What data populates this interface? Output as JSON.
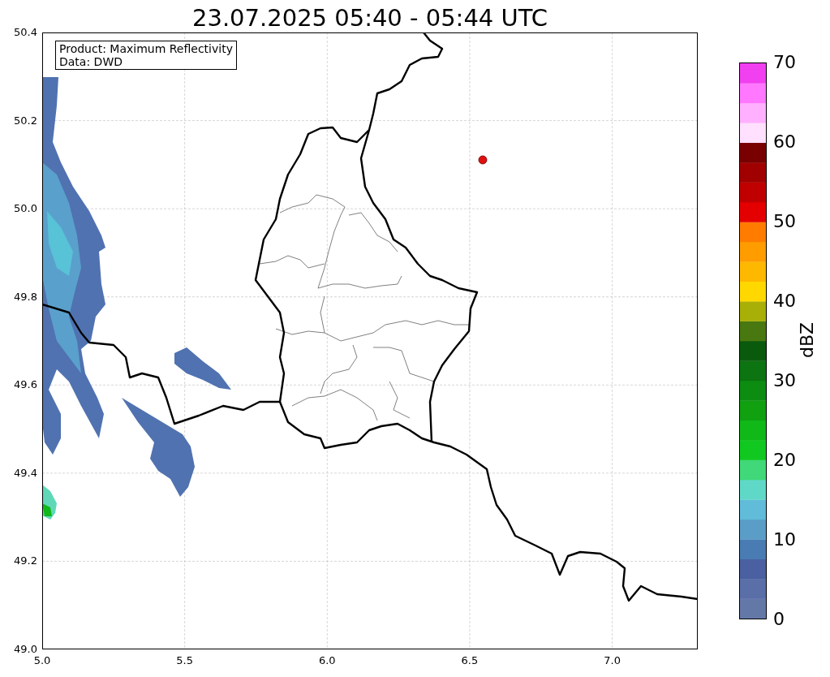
{
  "title": "23.07.2025 05:40 - 05:44 UTC",
  "map": {
    "info_box": [
      "Product: Maximum Reflectivity",
      "Data: DWD"
    ],
    "x_ticks": [
      "5.0",
      "5.5",
      "6.0",
      "6.5",
      "7.0"
    ],
    "y_ticks": [
      "50.4",
      "50.2",
      "50.0",
      "49.8",
      "49.6",
      "49.4",
      "49.2",
      "49.0"
    ]
  },
  "colorbar": {
    "label": "dBZ",
    "ticks": [
      "70",
      "60",
      "50",
      "40",
      "30",
      "20",
      "10",
      "0"
    ],
    "bands": [
      {
        "color": "#6478a8"
      },
      {
        "color": "#5a6ea8"
      },
      {
        "color": "#4a60a0"
      },
      {
        "color": "#4a7cb4"
      },
      {
        "color": "#5a9ec8"
      },
      {
        "color": "#60bcd8"
      },
      {
        "color": "#60d8c8"
      },
      {
        "color": "#40d878"
      },
      {
        "color": "#10c820"
      },
      {
        "color": "#10b818"
      },
      {
        "color": "#10a010"
      },
      {
        "color": "#0c8c10"
      },
      {
        "color": "#0c7410"
      },
      {
        "color": "#0a5a0e"
      },
      {
        "color": "#4a7810"
      },
      {
        "color": "#a8b008"
      },
      {
        "color": "#ffd800"
      },
      {
        "color": "#ffb800"
      },
      {
        "color": "#ff9c00"
      },
      {
        "color": "#ff7c00"
      },
      {
        "color": "#e40000"
      },
      {
        "color": "#c00000"
      },
      {
        "color": "#a00000"
      },
      {
        "color": "#780000"
      },
      {
        "color": "#ffe0ff"
      },
      {
        "color": "#ffb0ff"
      },
      {
        "color": "#ff78ff"
      },
      {
        "color": "#f040f0"
      }
    ]
  }
}
